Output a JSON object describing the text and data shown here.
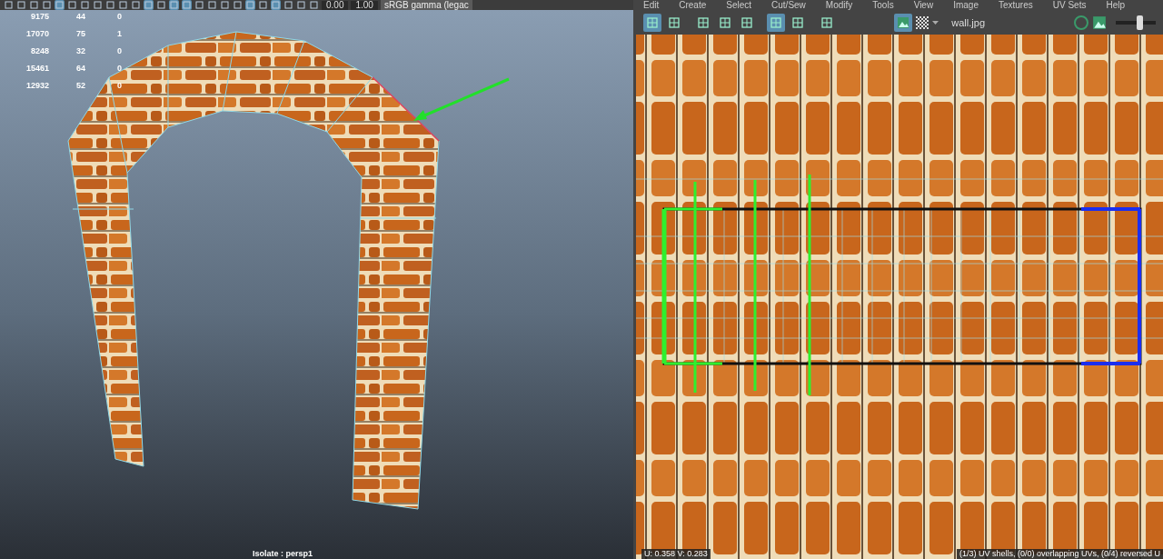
{
  "viewport": {
    "toolbar": {
      "icons": [
        {
          "selected": false
        },
        {
          "selected": false
        },
        {
          "selected": false
        },
        {
          "selected": false
        },
        {
          "selected": true
        },
        {
          "selected": false
        },
        {
          "selected": false
        },
        {
          "selected": false
        },
        {
          "selected": false
        },
        {
          "selected": false
        },
        {
          "selected": false
        },
        {
          "selected": true
        },
        {
          "selected": false
        },
        {
          "selected": true
        },
        {
          "selected": true
        },
        {
          "selected": false
        },
        {
          "selected": false
        },
        {
          "selected": false
        },
        {
          "selected": false
        },
        {
          "selected": true
        },
        {
          "selected": false
        },
        {
          "selected": true
        },
        {
          "selected": false
        },
        {
          "selected": false
        },
        {
          "selected": false
        }
      ],
      "exposure": "0.00",
      "gamma": "1.00",
      "color_space": "sRGB gamma (legac"
    },
    "stats": [
      [
        "9175",
        "44",
        "0"
      ],
      [
        "17070",
        "75",
        "1"
      ],
      [
        "8248",
        "32",
        "0"
      ],
      [
        "15461",
        "64",
        "0"
      ],
      [
        "12932",
        "52",
        "0"
      ]
    ],
    "footer": "Isolate : persp1"
  },
  "uv_editor": {
    "menu": [
      "Edit",
      "Create",
      "Select",
      "Cut/Sew",
      "Modify",
      "Tools",
      "View",
      "Image",
      "Textures",
      "UV Sets",
      "Help"
    ],
    "toolbar": {
      "icons": [
        {
          "selected": true
        },
        {
          "selected": false
        },
        {
          "selected": false
        },
        {
          "selected": false
        },
        {
          "selected": false
        },
        {
          "selected": true
        },
        {
          "selected": false
        },
        {
          "selected": false
        }
      ],
      "image_toggle": {
        "selected": true
      },
      "image_name": "wall.jpg",
      "slider": {
        "level": 0.6
      }
    },
    "status": {
      "coords": "U: 0.358 V: 0.283",
      "info": "(1/3) UV shells, (0/0) overlapping UVs, (0/4) reversed U"
    }
  }
}
